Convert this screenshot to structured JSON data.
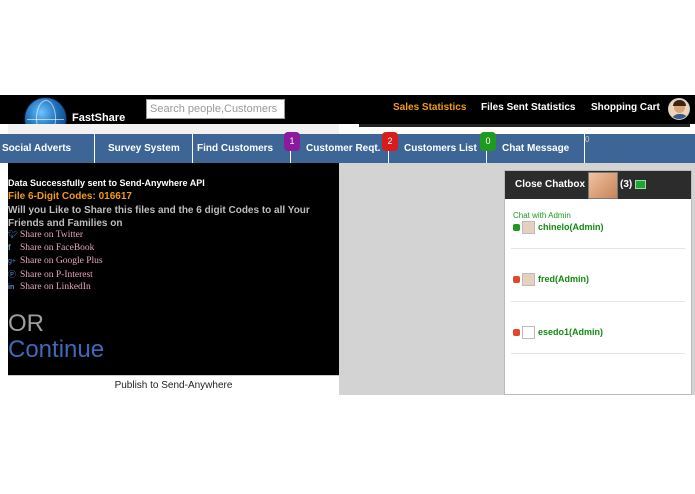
{
  "header": {
    "logo_text": "FastShare",
    "search_placeholder": "Search people,Customers",
    "links": [
      "Sales Statistics",
      "Files Sent Statistics",
      "Shopping Cart"
    ],
    "accent_color": "#f39c12"
  },
  "nav": {
    "items": [
      "Social Adverts",
      "Survey System",
      "Find Customers",
      "Customer Reqt.",
      "Customers List",
      "Chat Message"
    ],
    "badges": [
      {
        "count": "1",
        "color": "#8b1a9c"
      },
      {
        "count": "2",
        "color": "#d81b1b"
      },
      {
        "count": "0",
        "color": "#1e9a1e"
      }
    ],
    "trailing_badge": "0",
    "bar_color": "#3d6696"
  },
  "content": {
    "success_message": "Data Successfully sent to Send-Anywhere API",
    "code_label": "File 6-Digit Codes:",
    "code_value": "016617",
    "share_prompt": "Will you Like to Share this files and the 6 digit Codes to all Your Friends and Families on",
    "share_links": [
      {
        "icon": "twitter-icon",
        "label": "Share on Twitter"
      },
      {
        "icon": "facebook-icon",
        "label": "Share on FaceBook"
      },
      {
        "icon": "google-plus-icon",
        "label": "Share on Google Plus"
      },
      {
        "icon": "pinterest-icon",
        "label": "Share on P-Interest"
      },
      {
        "icon": "linkedin-icon",
        "label": "Share on LinkedIn"
      }
    ],
    "or_text": "OR",
    "continue_text": "Continue",
    "publish_label": "Publish to Send-Anywhere"
  },
  "chat": {
    "title": "Close Chatbox",
    "count": "(3)",
    "with_label": "Chat with Admin",
    "users": [
      {
        "name": "chinelo(Admin)",
        "status_color": "#1e9a1e"
      },
      {
        "name": "fred(Admin)",
        "status_color": "#e04a2a"
      },
      {
        "name": "esedo1(Admin)",
        "status_color": "#e04a2a"
      }
    ]
  }
}
